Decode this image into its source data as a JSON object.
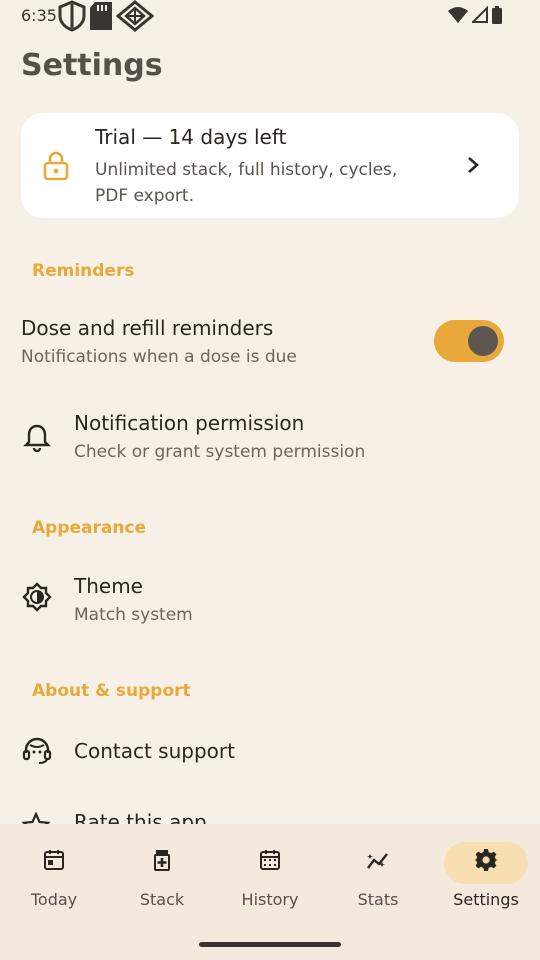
{
  "status": {
    "time": "6:35"
  },
  "page": {
    "title": "Settings"
  },
  "trial": {
    "title": "Trial — 14 days left",
    "description": "Unlimited stack, full history, cycles, PDF export.",
    "icon": "lock-icon"
  },
  "sections": {
    "reminders": "Reminders",
    "appearance": "Appearance",
    "about": "About & support"
  },
  "rows": {
    "reminders": {
      "title": "Dose and refill reminders",
      "subtitle": "Notifications when a dose is due",
      "enabled": true
    },
    "notification": {
      "title": "Notification permission",
      "subtitle": "Check or grant system permission",
      "icon": "bell-icon"
    },
    "theme": {
      "title": "Theme",
      "subtitle": "Match system",
      "icon": "brightness-icon"
    },
    "contact": {
      "title": "Contact support",
      "icon": "support-agent-icon"
    },
    "rate": {
      "title": "Rate this app",
      "icon": "star-icon"
    }
  },
  "nav": {
    "items": [
      {
        "label": "Today",
        "icon": "calendar-today-icon"
      },
      {
        "label": "Stack",
        "icon": "medication-icon"
      },
      {
        "label": "History",
        "icon": "calendar-month-icon"
      },
      {
        "label": "Stats",
        "icon": "stats-icon"
      },
      {
        "label": "Settings",
        "icon": "gear-icon",
        "active": true
      }
    ]
  },
  "colors": {
    "accent": "#E8A93A",
    "background": "#F7F0E6",
    "card": "#FFFFFF",
    "nav_active": "#F8DFB2"
  }
}
